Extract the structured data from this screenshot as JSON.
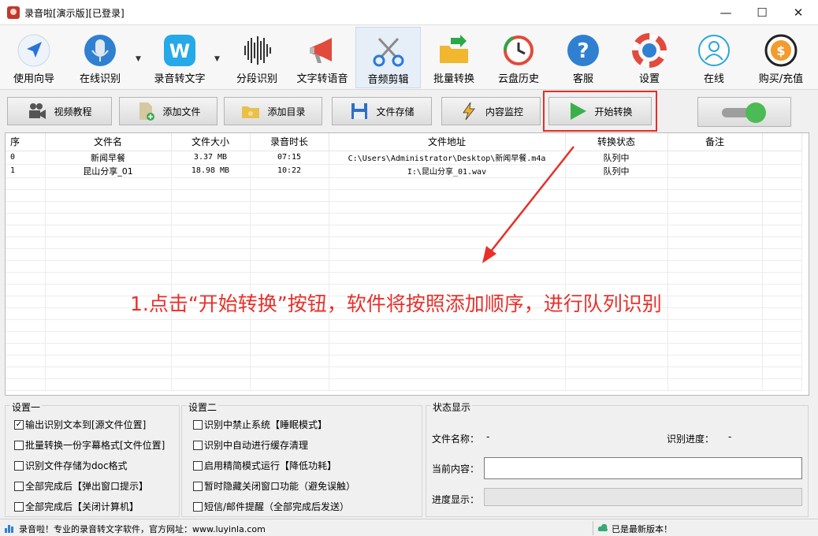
{
  "window": {
    "title": "录音啦[演示版][已登录]",
    "controls": {
      "minimize": "—",
      "maximize": "☐",
      "close": "✕"
    }
  },
  "toolbar": {
    "items": [
      {
        "label": "使用向导",
        "icon": "navigation-arrow-icon"
      },
      {
        "label": "在线识别",
        "icon": "microphone-icon"
      },
      {
        "label": "录音转文字",
        "icon": "w-app-icon"
      },
      {
        "label": "分段识别",
        "icon": "waveform-icon"
      },
      {
        "label": "文字转语音",
        "icon": "megaphone-icon"
      },
      {
        "label": "音频剪辑",
        "icon": "scissors-icon"
      },
      {
        "label": "批量转换",
        "icon": "folder-arrow-icon"
      },
      {
        "label": "云盘历史",
        "icon": "clock-history-icon"
      },
      {
        "label": "客服",
        "icon": "help-question-icon"
      },
      {
        "label": "设置",
        "icon": "lifebuoy-icon"
      },
      {
        "label": "在线",
        "icon": "user-online-icon"
      },
      {
        "label": "购买/充值",
        "icon": "dollar-coin-icon"
      }
    ],
    "active": "音频剪辑"
  },
  "actions": {
    "video_tutorial": "视频教程",
    "add_file": "添加文件",
    "add_folder": "添加目录",
    "file_storage": "文件存储",
    "content_monitor": "内容监控",
    "start_convert": "开始转换"
  },
  "table": {
    "headers": [
      "序",
      "文件名",
      "文件大小",
      "录音时长",
      "文件地址",
      "转换状态",
      "备注"
    ],
    "rows": [
      [
        "0",
        "新闻早餐",
        "3.37 MB",
        "07:15",
        "C:\\Users\\Administrator\\Desktop\\新闻早餐.m4a",
        "队列中",
        ""
      ],
      [
        "1",
        "昆山分享_01",
        "18.98 MB",
        "10:22",
        "I:\\昆山分享_01.wav",
        "队列中",
        ""
      ]
    ]
  },
  "annotation": "1.点击“开始转换”按钮，软件将按照添加顺序，进行队列识别",
  "settings1": {
    "title": "设置一",
    "options": [
      {
        "label": "输出识别文本到[源文件位置]",
        "checked": true
      },
      {
        "label": "批量转换一份字幕格式[文件位置]",
        "checked": false
      },
      {
        "label": "识别文件存储为doc格式",
        "checked": false
      },
      {
        "label": "全部完成后【弹出窗口提示】",
        "checked": false
      },
      {
        "label": "全部完成后【关闭计算机】",
        "checked": false
      }
    ]
  },
  "settings2": {
    "title": "设置二",
    "options": [
      {
        "label": "识别中禁止系统【睡眠模式】",
        "checked": false
      },
      {
        "label": "识别中自动进行缓存清理",
        "checked": false
      },
      {
        "label": "启用精简模式运行【降低功耗】",
        "checked": false
      },
      {
        "label": "暂时隐藏关闭窗口功能（避免误触）",
        "checked": false
      },
      {
        "label": "短信/邮件提醒（全部完成后发送）",
        "checked": false
      }
    ]
  },
  "status_panel": {
    "title": "状态显示",
    "file_name_label": "文件名称：",
    "file_name_value": "-",
    "progress_label": "识别进度：",
    "progress_value": "-",
    "current_content_label": "当前内容：",
    "progress_display_label": "进度显示：",
    "progress_fraction": 0
  },
  "statusbar": {
    "left": "录音啦！专业的录音转文字软件，官方网址：www.luyinla.com",
    "right": "已是最新版本！"
  },
  "colors": {
    "accent_red": "#e8302a",
    "toggle_green": "#4cbb55"
  }
}
